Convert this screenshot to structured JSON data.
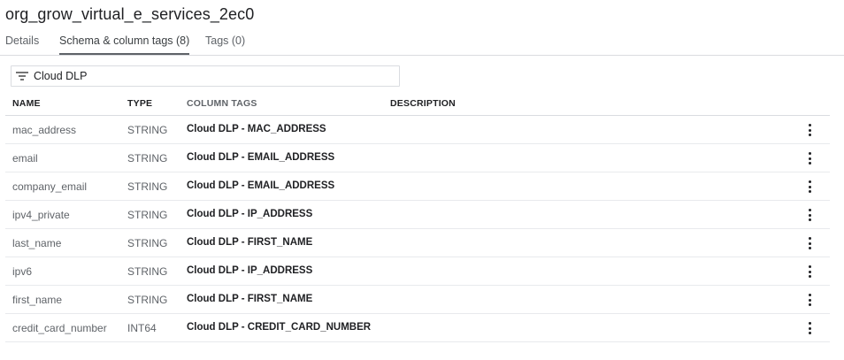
{
  "header": {
    "title": "org_grow_virtual_e_services_2ec0"
  },
  "tabs": [
    {
      "label": "Details"
    },
    {
      "label": "Schema & column tags (8)"
    },
    {
      "label": "Tags (0)"
    }
  ],
  "filter": {
    "value": "Cloud DLP",
    "icon": "filter-icon"
  },
  "table": {
    "columns": {
      "name": "NAME",
      "type": "TYPE",
      "tags": "COLUMN TAGS",
      "description": "DESCRIPTION"
    },
    "rows": [
      {
        "name": "mac_address",
        "type": "STRING",
        "tag": "Cloud DLP - MAC_ADDRESS"
      },
      {
        "name": "email",
        "type": "STRING",
        "tag": "Cloud DLP - EMAIL_ADDRESS"
      },
      {
        "name": "company_email",
        "type": "STRING",
        "tag": "Cloud DLP - EMAIL_ADDRESS"
      },
      {
        "name": "ipv4_private",
        "type": "STRING",
        "tag": "Cloud DLP - IP_ADDRESS"
      },
      {
        "name": "last_name",
        "type": "STRING",
        "tag": "Cloud DLP - FIRST_NAME"
      },
      {
        "name": "ipv6",
        "type": "STRING",
        "tag": "Cloud DLP - IP_ADDRESS"
      },
      {
        "name": "first_name",
        "type": "STRING",
        "tag": "Cloud DLP - FIRST_NAME"
      },
      {
        "name": "credit_card_number",
        "type": "INT64",
        "tag": "Cloud DLP - CREDIT_CARD_NUMBER"
      }
    ]
  },
  "icons": {
    "row_menu": "more-vert-icon"
  }
}
